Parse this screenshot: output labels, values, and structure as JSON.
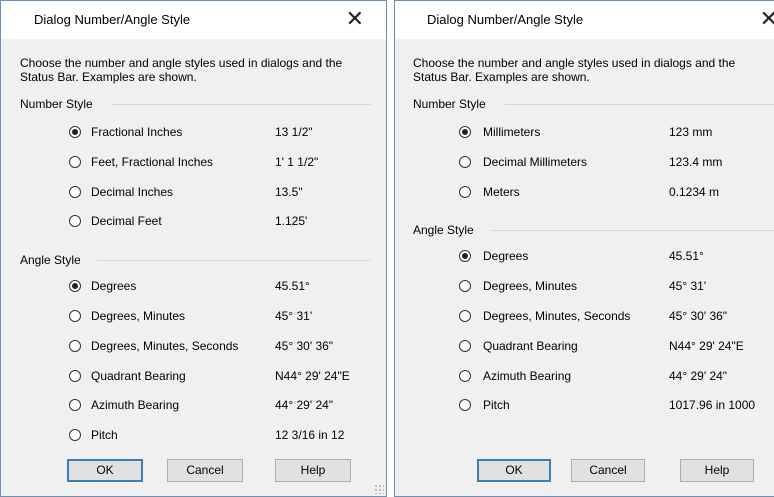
{
  "dialogs": [
    {
      "title": "Dialog Number/Angle Style",
      "description": "Choose the number and angle styles used in dialogs and the Status Bar.  Examples are shown.",
      "number_style": {
        "label": "Number Style",
        "options": [
          {
            "label": "Fractional Inches",
            "example": "13 1/2\"",
            "selected": true
          },
          {
            "label": "Feet, Fractional Inches",
            "example": "1' 1 1/2\"",
            "selected": false
          },
          {
            "label": "Decimal Inches",
            "example": "13.5\"",
            "selected": false
          },
          {
            "label": "Decimal Feet",
            "example": "1.125'",
            "selected": false
          }
        ]
      },
      "angle_style": {
        "label": "Angle Style",
        "options": [
          {
            "label": "Degrees",
            "example": "45.51°",
            "selected": true
          },
          {
            "label": "Degrees, Minutes",
            "example": "45° 31'",
            "selected": false
          },
          {
            "label": "Degrees, Minutes, Seconds",
            "example": "45° 30' 36\"",
            "selected": false
          },
          {
            "label": "Quadrant Bearing",
            "example": "N44° 29' 24\"E",
            "selected": false
          },
          {
            "label": "Azimuth Bearing",
            "example": "44° 29' 24\"",
            "selected": false
          },
          {
            "label": "Pitch",
            "example": "12 3/16 in 12",
            "selected": false
          }
        ]
      },
      "buttons": {
        "ok": "OK",
        "cancel": "Cancel",
        "help": "Help"
      }
    },
    {
      "title": "Dialog Number/Angle Style",
      "description": "Choose the number and angle styles used in dialogs and the Status Bar.  Examples are shown.",
      "number_style": {
        "label": "Number Style",
        "options": [
          {
            "label": "Millimeters",
            "example": "123 mm",
            "selected": true
          },
          {
            "label": "Decimal Millimeters",
            "example": "123.4 mm",
            "selected": false
          },
          {
            "label": "Meters",
            "example": "0.1234 m",
            "selected": false
          }
        ]
      },
      "angle_style": {
        "label": "Angle Style",
        "options": [
          {
            "label": "Degrees",
            "example": "45.51°",
            "selected": true
          },
          {
            "label": "Degrees, Minutes",
            "example": "45° 31'",
            "selected": false
          },
          {
            "label": "Degrees, Minutes, Seconds",
            "example": "45° 30' 36\"",
            "selected": false
          },
          {
            "label": "Quadrant Bearing",
            "example": "N44° 29' 24\"E",
            "selected": false
          },
          {
            "label": "Azimuth Bearing",
            "example": "44° 29' 24\"",
            "selected": false
          },
          {
            "label": "Pitch",
            "example": "1017.96 in 1000",
            "selected": false
          }
        ]
      },
      "buttons": {
        "ok": "OK",
        "cancel": "Cancel",
        "help": "Help"
      }
    }
  ]
}
